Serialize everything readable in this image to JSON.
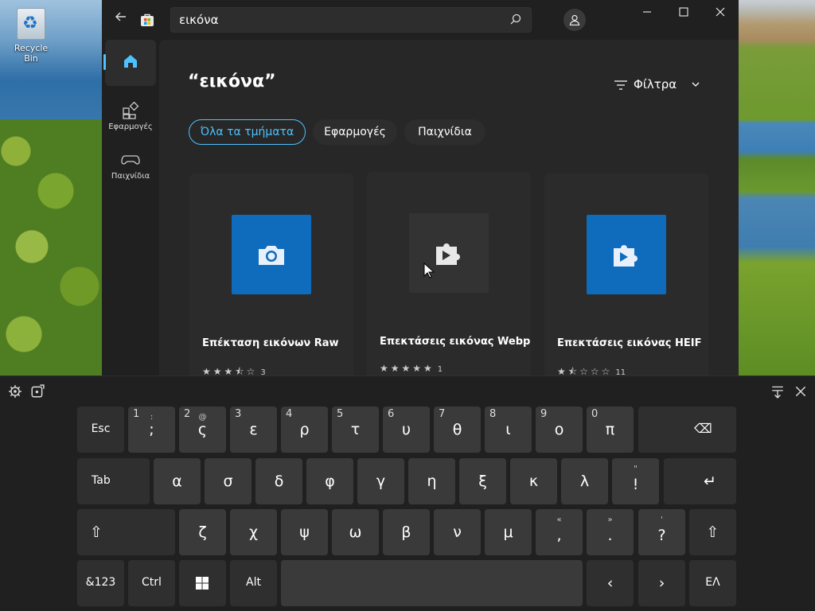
{
  "desktop": {
    "recycle_bin_label": "Recycle Bin"
  },
  "store": {
    "search": {
      "value": "εικόνα"
    },
    "nav": [
      {
        "label": "",
        "icon": "home-icon"
      },
      {
        "label": "Εφαρμογές",
        "icon": "apps-icon"
      },
      {
        "label": "Παιχνίδια",
        "icon": "gamepad-icon"
      }
    ],
    "query_title": "“εικόνα”",
    "filter_label": "Φίλτρα",
    "chips": [
      "Όλα τα τμήματα",
      "Εφαρμογές",
      "Παιχνίδια"
    ],
    "cards": [
      {
        "name": "Επέκταση εικόνων Raw",
        "rating_count": "3",
        "rating_stars": "★★★⯪☆",
        "icon": "camera-icon",
        "tile_color": "#0f6cbd"
      },
      {
        "name": "Επεκτάσεις εικόνας Webp",
        "rating_count": "1",
        "rating_stars": "★★★★★",
        "icon": "puzzle-play-icon",
        "tile_color": "#333333"
      },
      {
        "name": "Επεκτάσεις εικόνας HEIF",
        "rating_count": "11",
        "rating_stars": "★⯪☆☆☆",
        "icon": "puzzle-play-icon",
        "tile_color": "#0f6cbd"
      }
    ]
  },
  "keyboard": {
    "row1": [
      {
        "main": "Esc"
      },
      {
        "main": ";",
        "num": "1",
        "sec": ":"
      },
      {
        "main": "ς",
        "num": "2",
        "sec": "@"
      },
      {
        "main": "ε",
        "num": "3"
      },
      {
        "main": "ρ",
        "num": "4"
      },
      {
        "main": "τ",
        "num": "5"
      },
      {
        "main": "υ",
        "num": "6"
      },
      {
        "main": "θ",
        "num": "7"
      },
      {
        "main": "ι",
        "num": "8"
      },
      {
        "main": "ο",
        "num": "9"
      },
      {
        "main": "π",
        "num": "0"
      },
      {
        "main": "⌫"
      }
    ],
    "row2": [
      {
        "main": "Tab"
      },
      {
        "main": "α"
      },
      {
        "main": "σ"
      },
      {
        "main": "δ"
      },
      {
        "main": "φ"
      },
      {
        "main": "γ"
      },
      {
        "main": "η"
      },
      {
        "main": "ξ"
      },
      {
        "main": "κ"
      },
      {
        "main": "λ"
      },
      {
        "main": "!",
        "sec": "\""
      },
      {
        "main": "↵"
      }
    ],
    "row3": [
      {
        "main": "⇧"
      },
      {
        "main": "ζ"
      },
      {
        "main": "χ"
      },
      {
        "main": "ψ"
      },
      {
        "main": "ω"
      },
      {
        "main": "β"
      },
      {
        "main": "ν"
      },
      {
        "main": "μ"
      },
      {
        "main": ",",
        "sec": "«"
      },
      {
        "main": ".",
        "sec": "»"
      },
      {
        "main": "?",
        "sec": "'"
      },
      {
        "main": "⇧"
      }
    ],
    "row4": [
      {
        "main": "&123"
      },
      {
        "main": "Ctrl"
      },
      {
        "main": ""
      },
      {
        "main": "Alt"
      },
      {
        "main": ""
      },
      {
        "main": "‹"
      },
      {
        "main": "›"
      },
      {
        "main": "ΕΛ"
      }
    ]
  }
}
